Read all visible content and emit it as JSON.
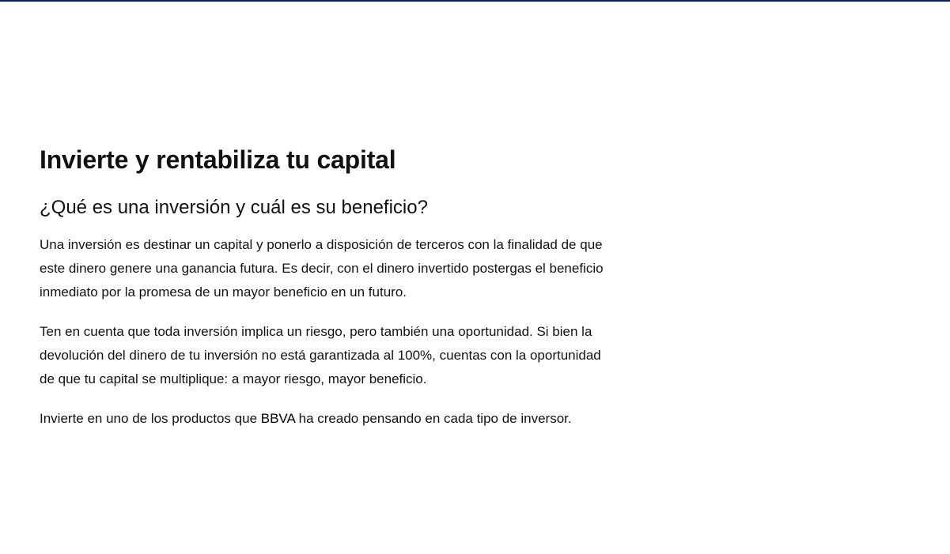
{
  "page": {
    "title": "Invierte y rentabiliza tu capital",
    "subtitle": "¿Qué es una inversión y cuál es su beneficio?",
    "paragraphs": {
      "p1": "Una inversión es destinar un capital y ponerlo a disposición de terceros con la finalidad de que este dinero genere una ganancia futura. Es decir, con el dinero invertido postergas el beneficio inmediato por la promesa de un mayor  beneficio en un futuro.",
      "p2": "Ten en cuenta que toda inversión implica un riesgo, pero también una  oportunidad. Si bien la devolución del dinero de tu inversión no está garantizada  al 100%, cuentas con la oportunidad de que tu capital se multiplique: a mayor  riesgo, mayor beneficio.",
      "p3": {
        "before": "Invierte en uno de los productos que ",
        "brand": "BBVA",
        "after": " ha creado pensando en  cada tipo de inversor."
      }
    }
  },
  "colors": {
    "top_border": "#072146",
    "text": "#121212",
    "background": "#ffffff"
  }
}
